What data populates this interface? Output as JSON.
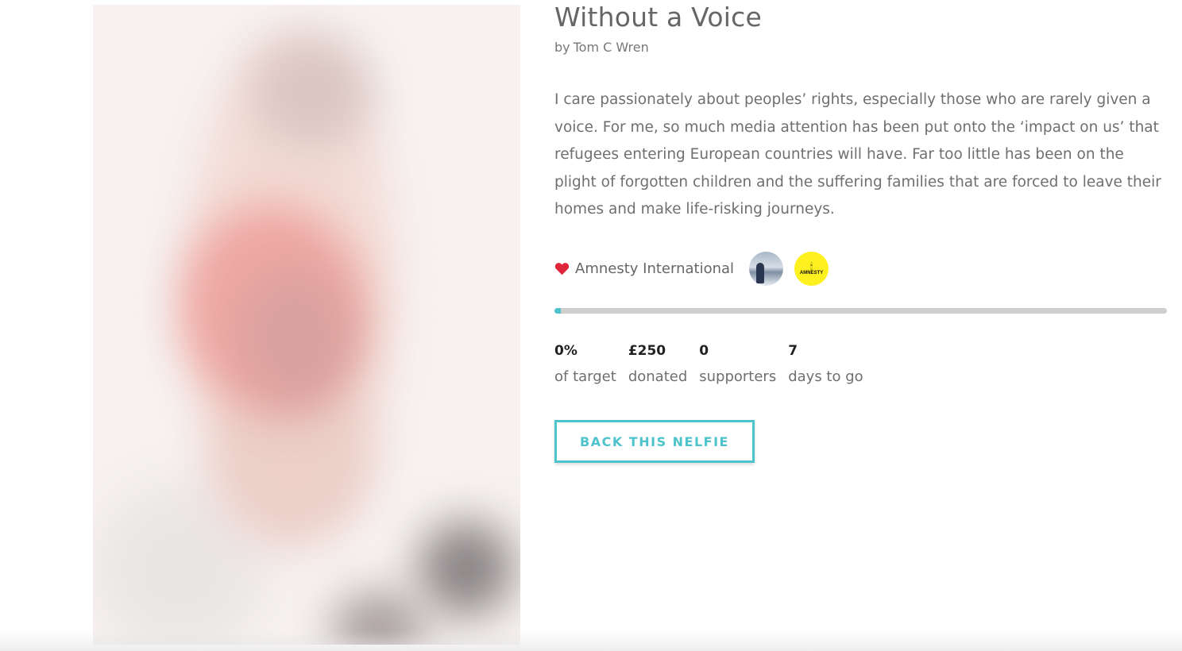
{
  "project": {
    "title": "Without a Voice",
    "author_prefix": "by",
    "author_name": "Tom C Wren",
    "description": "I care passionately about peoples’ rights, especially those who are rarely given a voice. For me, so much media attention has been put onto the ‘impact on us’ that refugees entering European countries will have. Far too little has been on the plight of forgotten children and the suffering families that are forced to leave their homes and make life-risking journeys.",
    "image_alt": "blurred-photo"
  },
  "charity": {
    "icon": "heart-icon",
    "name": "Amnesty International",
    "avatars": [
      {
        "name": "person-avatar",
        "icon": "person-photo"
      },
      {
        "name": "amnesty-logo",
        "logo_text": "AMNESTY INTERNATIONAL"
      }
    ]
  },
  "progress": {
    "fraction": 0.01
  },
  "stats": [
    {
      "value": "0%",
      "label": "of target"
    },
    {
      "value": "£250",
      "label": "donated"
    },
    {
      "value": "0",
      "label": "supporters"
    },
    {
      "value": "7",
      "label": "days to go"
    }
  ],
  "cta": {
    "label": "BACK THIS NELFIE"
  },
  "colors": {
    "accent": "#4fc3cb",
    "heart": "#e0263a",
    "amnesty_yellow": "#fff01f",
    "track": "#cfcfcf"
  }
}
